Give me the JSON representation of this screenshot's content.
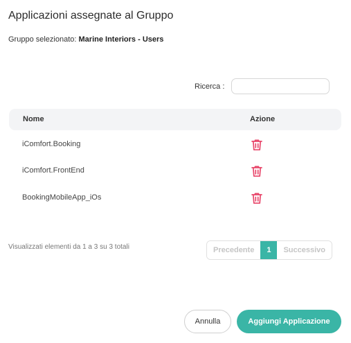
{
  "dialog": {
    "title": "Applicazioni assegnate al Gruppo",
    "subtitle_label": "Gruppo selezionato:",
    "group_name": "Marine Interiors - Users"
  },
  "search": {
    "label": "Ricerca :",
    "value": "",
    "placeholder": ""
  },
  "table": {
    "columns": [
      "Nome",
      "Azione"
    ],
    "rows": [
      {
        "name": "iComfort.Booking",
        "action_icon": "trash-icon"
      },
      {
        "name": "iComfort.FrontEnd",
        "action_icon": "trash-icon"
      },
      {
        "name": "BookingMobileApp_iOs",
        "action_icon": "trash-icon"
      }
    ]
  },
  "pagination": {
    "info": "Visualizzati elementi da 1 a 3 su 3 totali",
    "prev_label": "Precedente",
    "current_page": "1",
    "next_label": "Successivo"
  },
  "footer": {
    "cancel_label": "Annulla",
    "add_label": "Aggiungi Applicazione"
  },
  "colors": {
    "accent": "#3ab5a6",
    "delete": "#e8466a"
  }
}
